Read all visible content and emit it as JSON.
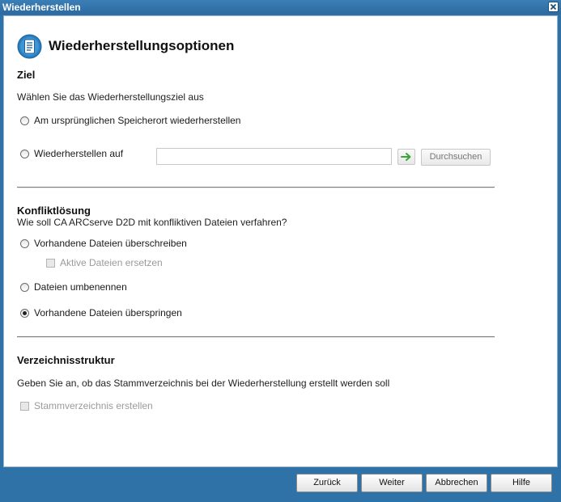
{
  "window": {
    "title": "Wiederherstellen"
  },
  "header": {
    "title": "Wiederherstellungsoptionen",
    "icon": "document-list-icon"
  },
  "destination": {
    "section_title": "Ziel",
    "instruction": "Wählen Sie das Wiederherstellungsziel aus",
    "options": [
      {
        "label": "Am ursprünglichen Speicherort wiederherstellen",
        "selected": false
      },
      {
        "label": "Wiederherstellen auf",
        "selected": false
      }
    ],
    "path_value": "",
    "go_icon": "arrow-right-icon",
    "browse_label": "Durchsuchen"
  },
  "conflict": {
    "section_title": "Konfliktlösung",
    "question": "Wie soll CA ARCserve D2D mit konfliktiven Dateien verfahren?",
    "options": [
      {
        "label": "Vorhandene Dateien überschreiben",
        "selected": false
      },
      {
        "label": "Dateien umbenennen",
        "selected": false
      },
      {
        "label": "Vorhandene Dateien überspringen",
        "selected": true
      }
    ],
    "replace_active_label": "Aktive Dateien ersetzen",
    "replace_active_checked": false
  },
  "directory": {
    "section_title": "Verzeichnisstruktur",
    "description": "Geben Sie an, ob das Stammverzeichnis bei der Wiederherstellung erstellt werden soll",
    "create_root_label": "Stammverzeichnis erstellen",
    "create_root_checked": false
  },
  "footer": {
    "back_label": "Zurück",
    "next_label": "Weiter",
    "cancel_label": "Abbrechen",
    "help_label": "Hilfe"
  },
  "colors": {
    "frame": "#2e72a8",
    "accent_icon": "#2a7fc0",
    "go_arrow": "#3aa53a"
  }
}
